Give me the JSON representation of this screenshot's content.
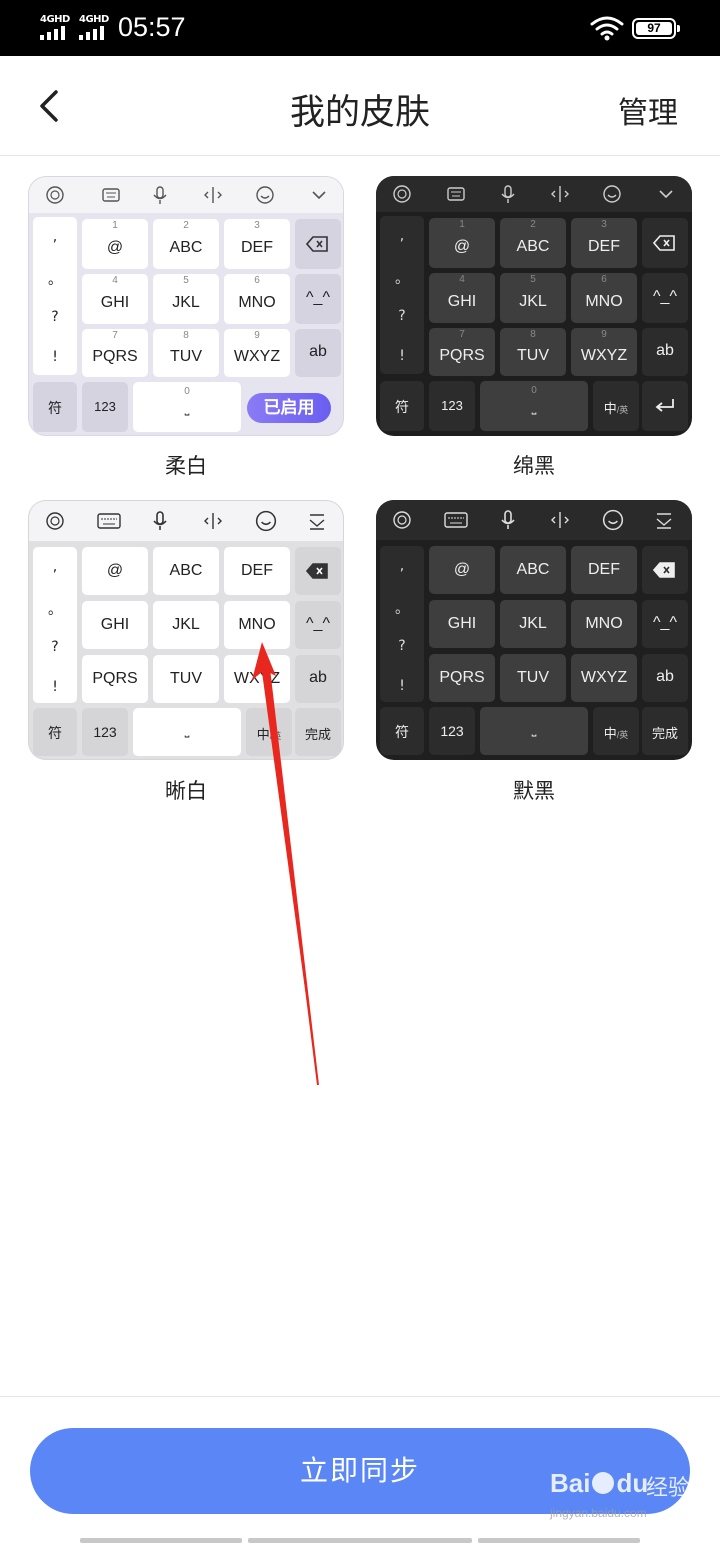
{
  "status_bar": {
    "sim1": "4GHD",
    "sim2": "4GHD",
    "time": "05:57",
    "battery": "97"
  },
  "header": {
    "title": "我的皮肤",
    "manage_label": "管理"
  },
  "skins": [
    {
      "name": "柔白",
      "badge": "已启用",
      "keys": {
        "row1": [
          {
            "num": "1",
            "txt": "@"
          },
          {
            "num": "2",
            "txt": "ABC"
          },
          {
            "num": "3",
            "txt": "DEF"
          }
        ],
        "row2": [
          {
            "num": "4",
            "txt": "GHI"
          },
          {
            "num": "5",
            "txt": "JKL"
          },
          {
            "num": "6",
            "txt": "MNO"
          }
        ],
        "row3": [
          {
            "num": "7",
            "txt": "PQRS"
          },
          {
            "num": "8",
            "txt": "TUV"
          },
          {
            "num": "9",
            "txt": "WXYZ"
          }
        ],
        "side": [
          "^_^",
          "ab"
        ],
        "bottom": [
          "符",
          "123",
          "0"
        ]
      }
    },
    {
      "name": "绵黑",
      "keys": {
        "row1": [
          {
            "num": "1",
            "txt": "@"
          },
          {
            "num": "2",
            "txt": "ABC"
          },
          {
            "num": "3",
            "txt": "DEF"
          }
        ],
        "row2": [
          {
            "num": "4",
            "txt": "GHI"
          },
          {
            "num": "5",
            "txt": "JKL"
          },
          {
            "num": "6",
            "txt": "MNO"
          }
        ],
        "row3": [
          {
            "num": "7",
            "txt": "PQRS"
          },
          {
            "num": "8",
            "txt": "TUV"
          },
          {
            "num": "9",
            "txt": "WXYZ"
          }
        ],
        "side": [
          "^_^",
          "ab"
        ],
        "bottom": [
          "符",
          "123",
          "0",
          "中",
          "英"
        ]
      }
    },
    {
      "name": "晰白",
      "keys": {
        "row1": [
          "@",
          "ABC",
          "DEF"
        ],
        "row2": [
          "GHI",
          "JKL",
          "MNO"
        ],
        "row3": [
          "PQRS",
          "TUV",
          "WXYZ"
        ],
        "side": [
          "^_^",
          "ab"
        ],
        "bottom": [
          "符",
          "123",
          "中",
          "英",
          "完成"
        ]
      }
    },
    {
      "name": "默黑",
      "keys": {
        "row1": [
          "@",
          "ABC",
          "DEF"
        ],
        "row2": [
          "GHI",
          "JKL",
          "MNO"
        ],
        "row3": [
          "PQRS",
          "TUV",
          "WXYZ"
        ],
        "side": [
          "^_^",
          "ab"
        ],
        "bottom": [
          "符",
          "123",
          "中",
          "英",
          "完成"
        ]
      }
    }
  ],
  "punctuation": [
    ",",
    "。",
    "?",
    "!"
  ],
  "sync_button": "立即同步",
  "watermark": {
    "logo": "Bai",
    "logo2": "du",
    "text": "经验",
    "url": "jingyan.baidu.com"
  },
  "colors": {
    "accent": "#5a86f6",
    "badge": "#7b6cf4",
    "arrow": "#e8281e"
  }
}
